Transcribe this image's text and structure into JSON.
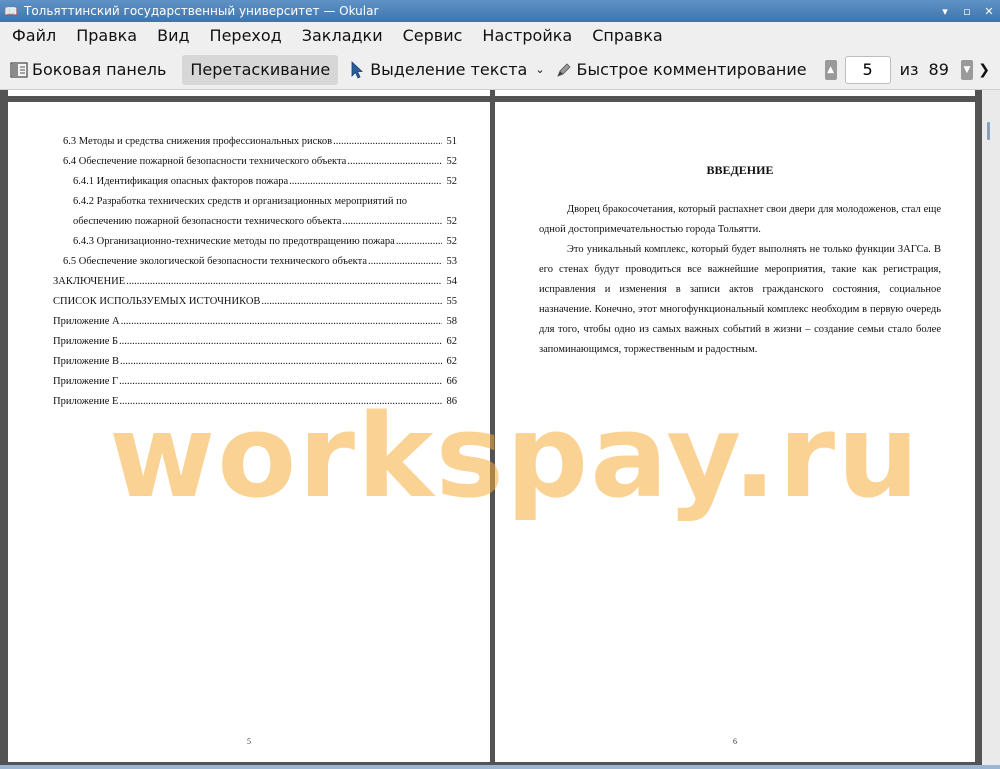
{
  "window": {
    "title": "Тольяттинский государственный университет  — Okular"
  },
  "menu": {
    "items": [
      "Файл",
      "Правка",
      "Вид",
      "Переход",
      "Закладки",
      "Сервис",
      "Настройка",
      "Справка"
    ]
  },
  "toolbar": {
    "sidebar_label": "Боковая панель",
    "drag_label": "Перетаскивание",
    "text_select_label": "Выделение текста",
    "comment_label": "Быстрое комментирование",
    "current_page": "5",
    "of_label": "из",
    "total_pages": "89"
  },
  "left_page": {
    "toc": [
      {
        "text": "6.3 Методы и средства снижения профессиональных рисков",
        "page": "51",
        "indent": 1
      },
      {
        "text": "6.4 Обеспечение пожарной безопасности технического объекта",
        "page": "52",
        "indent": 1
      },
      {
        "text": "6.4.1 Идентификация опасных факторов пожара",
        "page": "52",
        "indent": 2
      },
      {
        "text": "6.4.2 Разработка технических средств и организационных мероприятий по",
        "page": "",
        "indent": 2,
        "continued": true
      },
      {
        "text": "обеспечению пожарной безопасности технического объекта",
        "page": "52",
        "indent": 2
      },
      {
        "text": "6.4.3 Организационно-технические методы по предотвращению пожара",
        "page": "52",
        "indent": 2
      },
      {
        "text": "6.5 Обеспечение экологической безопасности технического объекта",
        "page": "53",
        "indent": 1
      },
      {
        "text": "ЗАКЛЮЧЕНИЕ",
        "page": "54",
        "indent": 0
      },
      {
        "text": "СПИСОК ИСПОЛЬЗУЕМЫХ ИСТОЧНИКОВ",
        "page": "55",
        "indent": 0
      },
      {
        "text": "Приложение А",
        "page": "58",
        "indent": 0
      },
      {
        "text": "Приложение Б",
        "page": "62",
        "indent": 0
      },
      {
        "text": "Приложение В",
        "page": "62",
        "indent": 0
      },
      {
        "text": "Приложение Г",
        "page": "66",
        "indent": 0
      },
      {
        "text": "Приложение Е",
        "page": "86",
        "indent": 0
      }
    ],
    "page_number": "5"
  },
  "right_page": {
    "heading": "ВВЕДЕНИЕ",
    "paragraphs": [
      "Дворец бракосочетания, который распахнет свои двери для молодоженов, стал еще одной достопримечательностью города Тольятти.",
      "Это уникальный комплекс, который будет выполнять не только функции ЗАГСа. В его стенах будут проводиться все важнейшие мероприятия, такие как регистрация, исправления и изменения в записи актов гражданского состояния, социальное назначение. Конечно, этот многофункциональный комплекс необходим в первую очередь для того, чтобы одно из самых важных событий в жизни – создание семьи стало более запоминающимся, торжественным и радостным."
    ],
    "page_number": "6"
  },
  "watermark": "workspay.ru"
}
